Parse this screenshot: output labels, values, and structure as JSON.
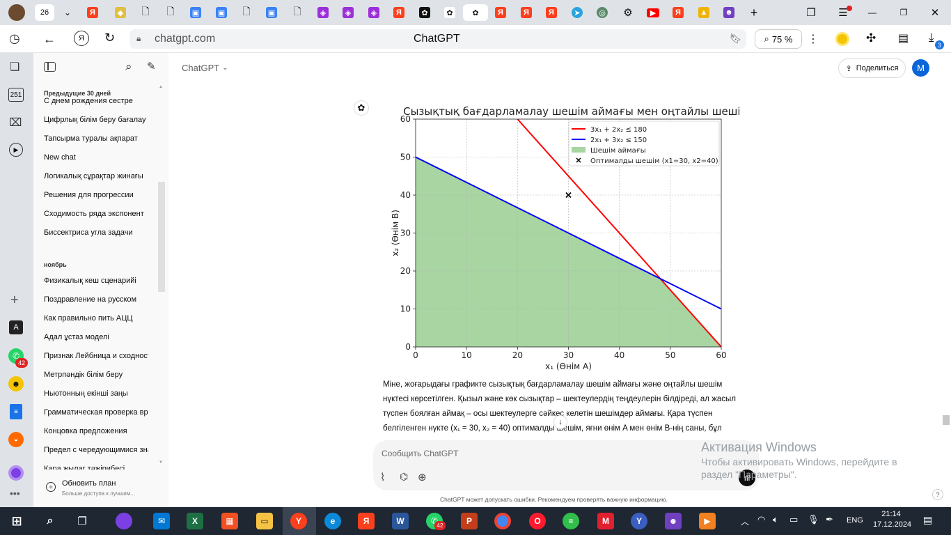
{
  "tabs": {
    "counter": "26",
    "new_tab": "+"
  },
  "toolbar": {
    "url": "chatgpt.com",
    "page_title": "ChatGPT",
    "zoom": "75 %",
    "download_badge": "3"
  },
  "browser_sidebar": {
    "badge_251": "251",
    "letter_a": "A",
    "whatsapp_badge": "42"
  },
  "chat_sidebar": {
    "section_1": "Предыдущие 30 дней",
    "items_1": [
      "С днем рождения сестре",
      "Цифрлық білім беру бағалау",
      "Тапсырма туралы ақпарат",
      "New chat",
      "Логикалық сұрақтар жинағы",
      "Решения для прогрессии",
      "Сходимость ряда экспонент",
      "Биссектриса угла задачи"
    ],
    "section_2": "ноябрь",
    "items_2": [
      "Физикалық кеш сценарийі",
      "Поздравление на русском",
      "Как правильно пить АЦЦ",
      "Адал ұстаз моделі",
      "Признак Лейбница и сходност",
      "Метрпәндік білім беру",
      "Ньютонның екінші заңы",
      "Грамматическая проверка вре",
      "Концовка предложения",
      "Предел с чередующимися зна",
      "Кара жылаг тәжірибесі"
    ],
    "upgrade_title": "Обновить план",
    "upgrade_sub": "Больше доступа к лучшим..."
  },
  "header": {
    "model": "ChatGPT",
    "share": "Поделиться",
    "avatar": "M"
  },
  "chart_data": {
    "type": "line",
    "title": "Сызықтық бағдарламалау шешім аймағы мен оңтайлы шешім",
    "xlabel": "x₁ (Өнім A)",
    "ylabel": "x₂ (Өнім B)",
    "xlim": [
      0,
      60
    ],
    "ylim": [
      0,
      60
    ],
    "xticks": [
      "0",
      "10",
      "20",
      "30",
      "40",
      "50",
      "60"
    ],
    "yticks": [
      "0",
      "10",
      "20",
      "30",
      "40",
      "50",
      "60"
    ],
    "grid": true,
    "legend_position": "top-right",
    "series": [
      {
        "name": "3x₁ + 2x₂ ≤ 180",
        "color": "#ff0000",
        "x": [
          20,
          60
        ],
        "y": [
          60,
          0
        ]
      },
      {
        "name": "2x₁ + 3x₂ ≤ 150",
        "color": "#0000ff",
        "x": [
          0,
          60
        ],
        "y": [
          50,
          10
        ]
      }
    ],
    "region": {
      "name": "Шешім аймағы",
      "color": "#a8d5a2",
      "x": [
        0,
        0,
        48,
        60
      ],
      "y": [
        0,
        50,
        18,
        0
      ]
    },
    "optimum": {
      "name": "Оптималды шешім (x1=30, x2=40)",
      "x": 30,
      "y": 40
    }
  },
  "message": {
    "lines": [
      "Міне, жоғарыдағы графикте сызықтық бағдарламалау шешім аймағы және оңтайлы шешім",
      "нүктесі көрсетілген. Қызыл және көк сызықтар – шектеулердің теңдеулерін білдіреді, ал жасыл",
      "түспен боялған аймақ – осы шектеулерге сәйкес келетін шешімдер аймағы. Қара түспен",
      "белгіленген нүкте (x₁ = 30, x₂ = 40) оптималды шешім, яғни өнім A мен өнім B-нің саны, бұл"
    ]
  },
  "composer": {
    "placeholder": "Сообщить ChatGPT",
    "disclaimer": "ChatGPT может допускать ошибки. Рекомендуем проверять важную информацию.",
    "help": "?"
  },
  "watermark": {
    "line1": "Активация Windows",
    "line2": "Чтобы активировать Windows, перейдите в",
    "line3": "раздел \"Параметры\"."
  },
  "taskbar": {
    "lang": "ENG",
    "time": "21:14",
    "date": "17.12.2024",
    "whatsapp_badge": "42"
  },
  "colors": {
    "accent": "#0a66d8",
    "taskbar": "#1f2733"
  }
}
